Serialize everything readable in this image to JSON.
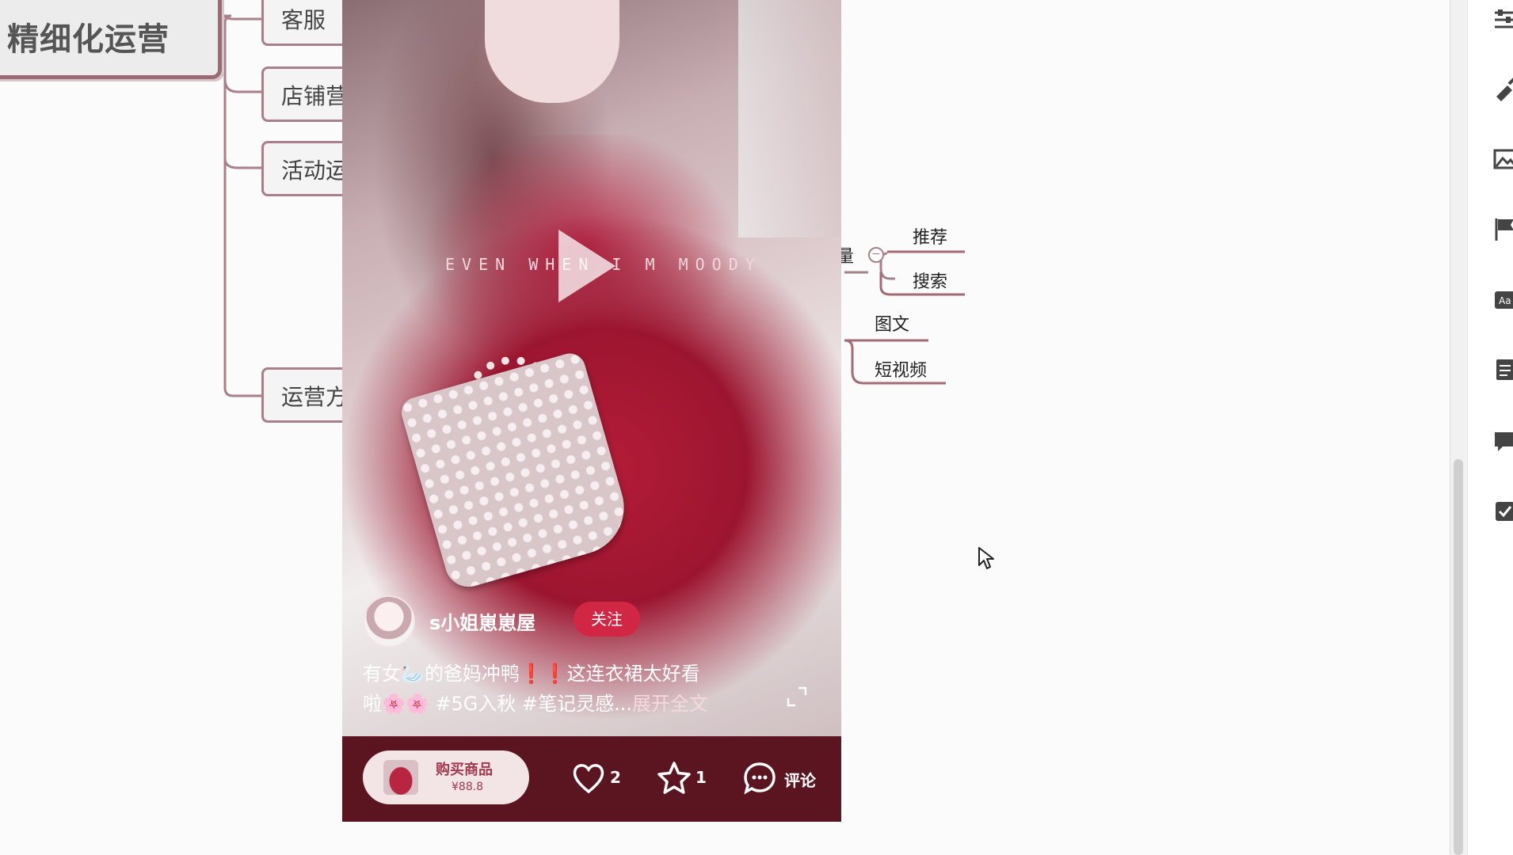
{
  "mindmap": {
    "root_label": "精细化运营",
    "branches": [
      {
        "label": "客服"
      },
      {
        "label": "店铺营"
      },
      {
        "label": "活动运"
      },
      {
        "label": "运营方"
      }
    ],
    "sub_nodes": [
      {
        "label": "推荐"
      },
      {
        "label": "搜索"
      },
      {
        "label": "图文"
      },
      {
        "label": "短视频"
      }
    ],
    "partial_label": "量"
  },
  "video": {
    "overlay_text": "EVEN WHEN I M MOODY",
    "author": "s小姐崽崽屋",
    "follow_label": "关注",
    "caption_line1": "有女🦢的爸妈冲鸭❗❗这连衣裙太好看",
    "caption_line2": "啦🌸🌸 #5G入秋 #笔记灵感...",
    "expand_label": "展开全文",
    "buy_label": "购买商品",
    "price": "¥88.8",
    "like_count": "2",
    "favorite_count": "1",
    "comment_label": "评论"
  },
  "colors": {
    "accent": "#d12745",
    "node_border": "#a88089",
    "phone_bg": "#5a1520"
  },
  "icons": {
    "side": [
      "sliders-icon",
      "brush-icon",
      "image-icon",
      "flag-icon",
      "text-style-icon",
      "note-icon",
      "comment-icon",
      "task-icon"
    ]
  }
}
